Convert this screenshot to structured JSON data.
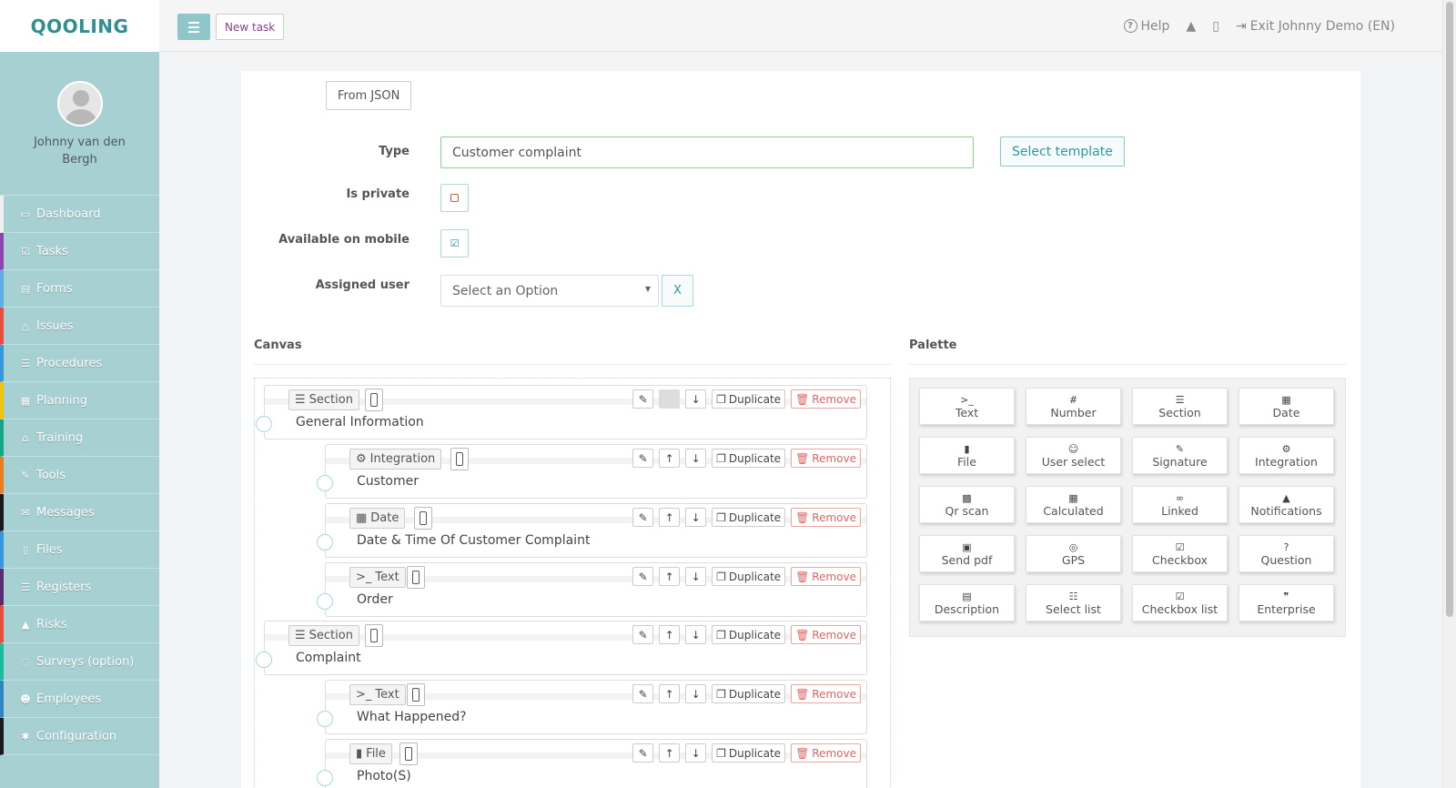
{
  "app": {
    "logo": "QOOLING"
  },
  "profile": {
    "name": "Johnny van den Bergh"
  },
  "nav": [
    {
      "label": "Dashboard",
      "icon": "monitor-icon",
      "glyph": "▭",
      "accent": "#f0f0f0"
    },
    {
      "label": "Tasks",
      "icon": "check-square-icon",
      "glyph": "☑",
      "accent": "#8e44ad"
    },
    {
      "label": "Forms",
      "icon": "file-icon",
      "glyph": "▤",
      "accent": "#5dade2"
    },
    {
      "label": "Issues",
      "icon": "bell-icon",
      "glyph": "△",
      "accent": "#e74c3c"
    },
    {
      "label": "Procedures",
      "icon": "list-icon",
      "glyph": "☰",
      "accent": "#3498db"
    },
    {
      "label": "Planning",
      "icon": "calendar-icon",
      "glyph": "▦",
      "accent": "#f1c40f"
    },
    {
      "label": "Training",
      "icon": "graduation-cap-icon",
      "glyph": "⌂",
      "accent": "#17a589"
    },
    {
      "label": "Tools",
      "icon": "wrench-icon",
      "glyph": "✎",
      "accent": "#e67e22"
    },
    {
      "label": "Messages",
      "icon": "envelope-icon",
      "glyph": "✉",
      "accent": "#1a1a1a"
    },
    {
      "label": "Files",
      "icon": "file-text-icon",
      "glyph": "▯",
      "accent": "#3498db"
    },
    {
      "label": "Registers",
      "icon": "list-alt-icon",
      "glyph": "☰",
      "accent": "#5b2c6f"
    },
    {
      "label": "Risks",
      "icon": "warning-icon",
      "glyph": "▲",
      "accent": "#e74c3c"
    },
    {
      "label": "Surveys (option)",
      "icon": "comment-icon",
      "glyph": "◌",
      "accent": "#1abc9c"
    },
    {
      "label": "Employees",
      "icon": "users-icon",
      "glyph": "☻",
      "accent": "#2e86c1"
    },
    {
      "label": "Configuration",
      "icon": "gear-icon",
      "glyph": "✱",
      "accent": "#1a1a1a"
    }
  ],
  "topbar": {
    "new_task": "New task",
    "help": "Help",
    "exit": "Exit Johnny Demo (EN)"
  },
  "form": {
    "from_json": "From JSON",
    "type_label": "Type",
    "type_value": "Customer complaint",
    "select_template": "Select template",
    "is_private_label": "Is private",
    "is_private": false,
    "available_mobile_label": "Available on mobile",
    "available_mobile": true,
    "assigned_user_label": "Assigned user",
    "assigned_user_placeholder": "Select an Option",
    "clear_label": "X"
  },
  "canvas": {
    "title": "Canvas",
    "duplicate_label": "Duplicate",
    "remove_label": "Remove",
    "elements": [
      {
        "type": "Section",
        "type_icon": "☰",
        "title": "General Information",
        "level": 0,
        "up_disabled": true
      },
      {
        "type": "Integration",
        "type_icon": "⚙",
        "title": "Customer",
        "level": 1,
        "up_disabled": false
      },
      {
        "type": "Date",
        "type_icon": "▦",
        "title": "Date & Time Of Customer Complaint",
        "level": 1,
        "up_disabled": false
      },
      {
        "type": "Text",
        "type_icon": ">_",
        "title": "Order",
        "level": 1,
        "up_disabled": false
      },
      {
        "type": "Section",
        "type_icon": "☰",
        "title": "Complaint",
        "level": 0,
        "up_disabled": false
      },
      {
        "type": "Text",
        "type_icon": ">_",
        "title": "What Happened?",
        "level": 1,
        "up_disabled": false
      },
      {
        "type": "File",
        "type_icon": "▮",
        "title": "Photo(S)",
        "level": 1,
        "up_disabled": false
      }
    ]
  },
  "palette": {
    "title": "Palette",
    "items": [
      {
        "label": "Text",
        "icon": "terminal-icon",
        "glyph": ">_"
      },
      {
        "label": "Number",
        "icon": "hash-icon",
        "glyph": "#"
      },
      {
        "label": "Section",
        "icon": "list-icon",
        "glyph": "☰"
      },
      {
        "label": "Date",
        "icon": "calendar-icon",
        "glyph": "▦"
      },
      {
        "label": "File",
        "icon": "file-icon",
        "glyph": "▮"
      },
      {
        "label": "User select",
        "icon": "user-circle-icon",
        "glyph": "☺"
      },
      {
        "label": "Signature",
        "icon": "pen-square-icon",
        "glyph": "✎"
      },
      {
        "label": "Integration",
        "icon": "cogs-icon",
        "glyph": "⚙"
      },
      {
        "label": "Qr scan",
        "icon": "qrcode-icon",
        "glyph": "▩"
      },
      {
        "label": "Calculated",
        "icon": "calculator-icon",
        "glyph": "▦"
      },
      {
        "label": "Linked",
        "icon": "link-icon",
        "glyph": "∞"
      },
      {
        "label": "Notifications",
        "icon": "bell-icon",
        "glyph": "▲"
      },
      {
        "label": "Send pdf",
        "icon": "image-icon",
        "glyph": "▣"
      },
      {
        "label": "GPS",
        "icon": "crosshairs-icon",
        "glyph": "◎"
      },
      {
        "label": "Checkbox",
        "icon": "check-square-icon",
        "glyph": "☑"
      },
      {
        "label": "Question",
        "icon": "question-circle-icon",
        "glyph": "?"
      },
      {
        "label": "Description",
        "icon": "file-text-icon",
        "glyph": "▤"
      },
      {
        "label": "Select list",
        "icon": "list-ol-icon",
        "glyph": "☷"
      },
      {
        "label": "Checkbox list",
        "icon": "check-square-icon",
        "glyph": "☑"
      },
      {
        "label": "Enterprise",
        "icon": "quote-icon",
        "glyph": "❞"
      }
    ]
  }
}
